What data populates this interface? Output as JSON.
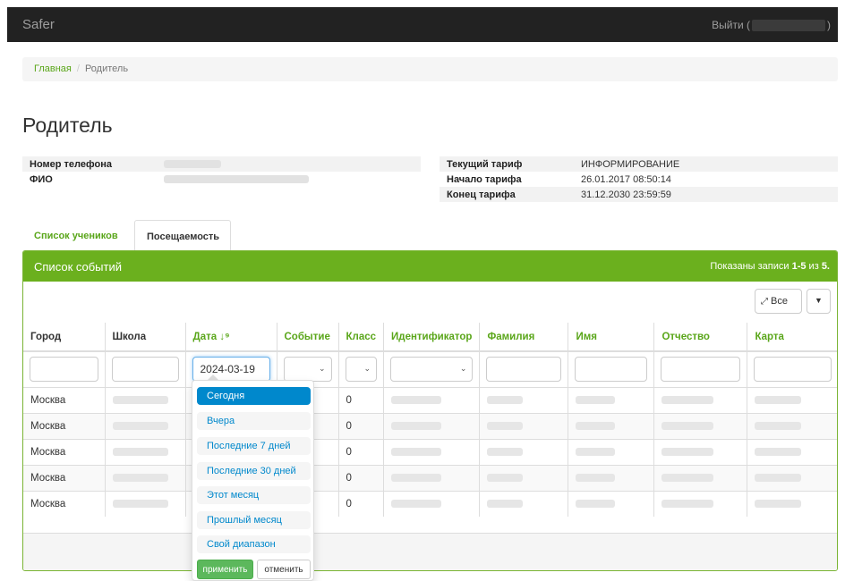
{
  "navbar": {
    "brand": "Safer",
    "logout_prefix": "Выйти (",
    "logout_suffix": ")"
  },
  "breadcrumb": {
    "home": "Главная",
    "separator": "/",
    "current": "Родитель"
  },
  "page_title": "Родитель",
  "info_left": [
    {
      "key": "Номер телефона",
      "value": ""
    },
    {
      "key": "ФИО",
      "value": ""
    }
  ],
  "info_right": [
    {
      "key": "Текущий тариф",
      "value": "ИНФОРМИРОВАНИЕ"
    },
    {
      "key": "Начало тарифа",
      "value": "26.01.2017 08:50:14"
    },
    {
      "key": "Конец тарифа",
      "value": "31.12.2030 23:59:59"
    }
  ],
  "tabs": [
    {
      "label": "Список учеников"
    },
    {
      "label": "Посещаемость"
    }
  ],
  "panel": {
    "title": "Список событий",
    "summary_prefix": "Показаны записи ",
    "summary_range": "1-5",
    "summary_mid": " из ",
    "summary_total": "5.",
    "all_button": "Все"
  },
  "columns": [
    "Город",
    "Школа",
    "Дата",
    "Событие",
    "Класс",
    "Идентификатор",
    "Фамилия",
    "Имя",
    "Отчество",
    "Карта"
  ],
  "sort_icon": "sort-numeric-down-icon",
  "filters": {
    "date_value": "2024-03-19"
  },
  "rows": [
    {
      "city": "Москва",
      "class": "0"
    },
    {
      "city": "Москва",
      "class": "0"
    },
    {
      "city": "Москва",
      "class": "0"
    },
    {
      "city": "Москва",
      "class": "0"
    },
    {
      "city": "Москва",
      "class": "0"
    }
  ],
  "date_picker": {
    "ranges": [
      "Сегодня",
      "Вчера",
      "Последние 7 дней",
      "Последние 30 дней",
      "Этот месяц",
      "Прошлый месяц",
      "Свой диапазон"
    ],
    "active_index": 0,
    "apply_label": "применить",
    "cancel_label": "отменить"
  },
  "colors": {
    "navbar": "#222222",
    "accent": "#6bb01e",
    "link": "#5aa61a",
    "active_range": "#0088cc",
    "apply": "#5cb85c"
  }
}
